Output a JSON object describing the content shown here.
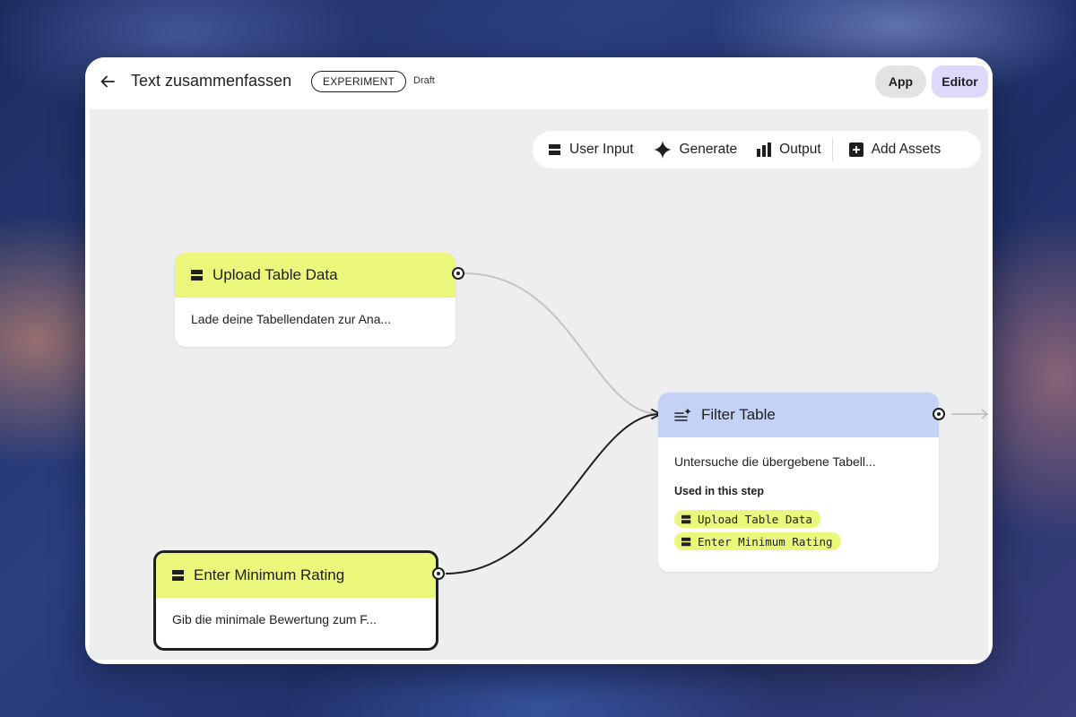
{
  "header": {
    "title": "Text zusammenfassen",
    "badge": "EXPERIMENT",
    "status": "Draft",
    "app_label": "App",
    "editor_label": "Editor"
  },
  "toolbar": {
    "user_input": "User Input",
    "generate": "Generate",
    "output": "Output",
    "add_assets": "Add Assets"
  },
  "nodes": {
    "upload": {
      "title": "Upload Table Data",
      "description": "Lade deine Tabellendaten zur Ana..."
    },
    "rating": {
      "title": "Enter Minimum Rating",
      "description": "Gib die minimale Bewertung zum F..."
    },
    "filter": {
      "title": "Filter Table",
      "description": "Untersuche die übergebene Tabell...",
      "used_label": "Used in this step",
      "used_items": [
        "Upload Table Data",
        "Enter Minimum Rating"
      ]
    }
  },
  "colors": {
    "input_node": "#eaf77a",
    "generate_node": "#c4d3f5",
    "editor_active": "#dcd9fb",
    "canvas": "#eeeeee"
  },
  "icons": {
    "back": "arrow-left-icon",
    "input": "input-bars-icon",
    "generate": "sparkle-icon",
    "output": "bar-chart-icon",
    "add": "plus-box-icon",
    "filter": "sparkle-list-icon"
  }
}
